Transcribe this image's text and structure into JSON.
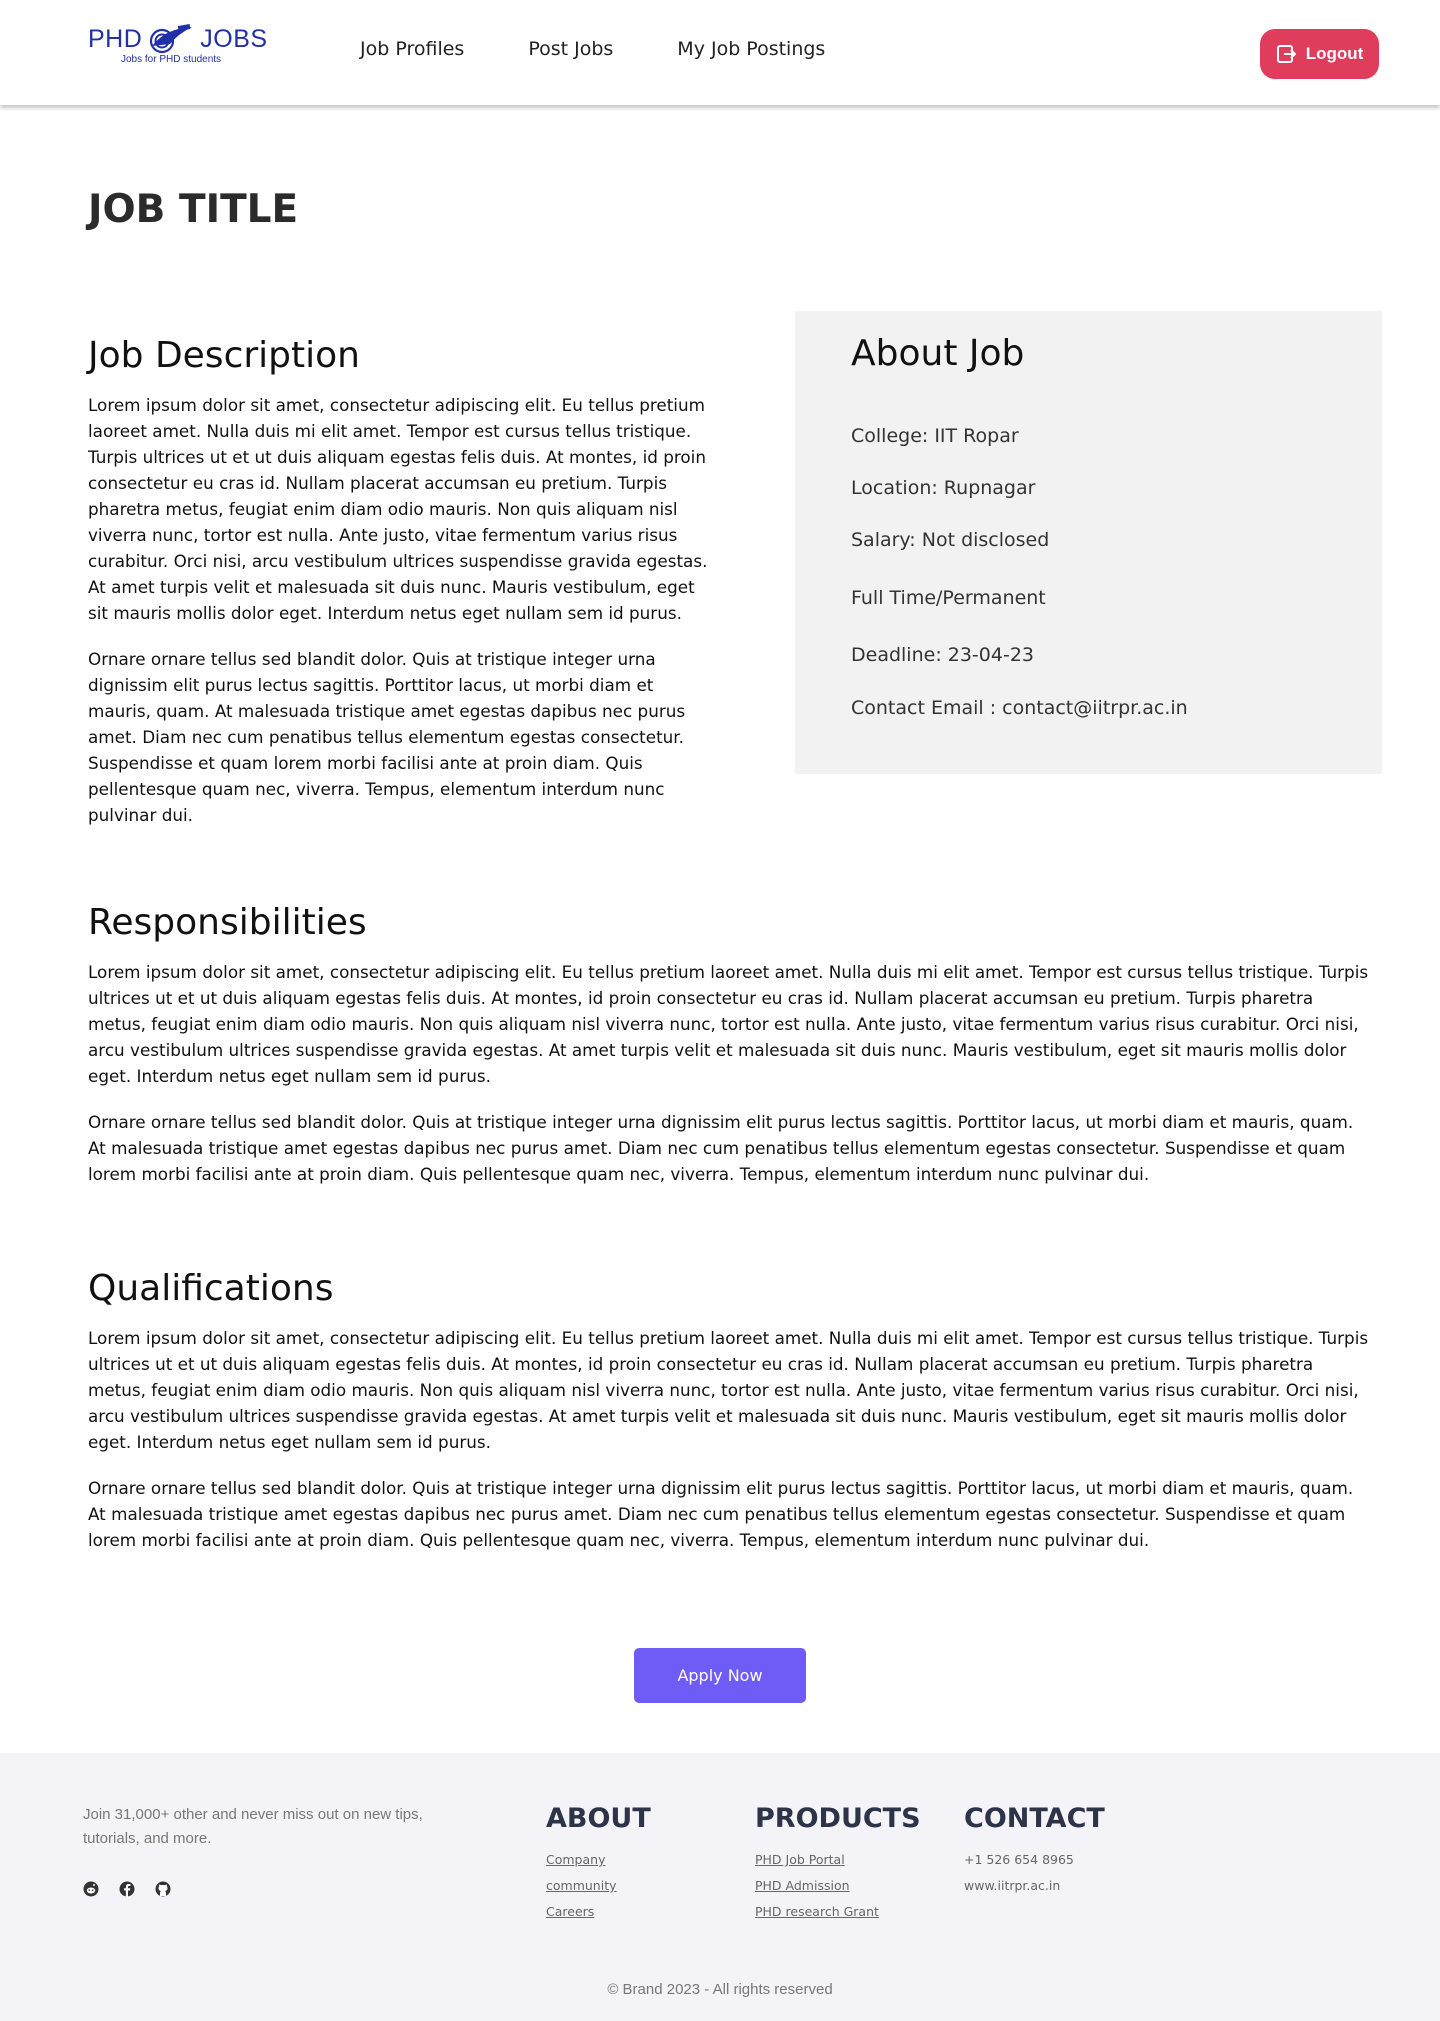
{
  "header": {
    "logo": {
      "word1": "PHD",
      "word2": "JOBS",
      "tagline": "Jobs for PHD students"
    },
    "nav": [
      {
        "label": "Job Profiles"
      },
      {
        "label": "Post Jobs"
      },
      {
        "label": "My Job Postings"
      }
    ],
    "logout_label": "Logout"
  },
  "job": {
    "title": "JOB TITLE",
    "description": {
      "heading": "Job Description",
      "paragraphs": [
        "Lorem ipsum dolor sit amet, consectetur adipiscing elit. Eu tellus pretium laoreet amet. Nulla duis mi elit amet. Tempor est cursus tellus tristique. Turpis ultrices ut et ut duis aliquam egestas felis duis. At montes, id proin consectetur eu cras id. Nullam placerat accumsan eu pretium. Turpis pharetra metus, feugiat enim diam odio mauris. Non quis aliquam nisl viverra nunc, tortor est nulla. Ante justo, vitae fermentum varius risus curabitur. Orci nisi, arcu vestibulum ultrices suspendisse gravida egestas. At amet turpis velit et malesuada sit duis nunc. Mauris vestibulum, eget sit mauris mollis dolor eget. Interdum netus eget nullam sem id purus.",
        "Ornare ornare tellus sed blandit dolor. Quis at tristique integer urna dignissim elit purus lectus sagittis. Porttitor lacus, ut morbi diam et mauris, quam. At malesuada tristique amet egestas dapibus nec purus amet. Diam nec cum penatibus tellus elementum egestas consectetur. Suspendisse et quam lorem morbi facilisi ante at proin diam. Quis pellentesque quam nec, viverra. Tempus, elementum interdum nunc pulvinar dui."
      ]
    },
    "about": {
      "heading": "About Job",
      "college": "College: IIT Ropar",
      "location": "Location: Rupnagar",
      "salary": "Salary: Not disclosed",
      "type": "Full Time/Permanent",
      "deadline": "Deadline: 23-04-23",
      "email": "Contact Email : contact@iitrpr.ac.in"
    },
    "responsibilities": {
      "heading": "Responsibilities",
      "paragraphs": [
        "Lorem ipsum dolor sit amet, consectetur adipiscing elit. Eu tellus pretium laoreet amet. Nulla duis mi elit amet. Tempor est cursus tellus tristique. Turpis ultrices ut et ut duis aliquam egestas felis duis. At montes, id proin consectetur eu cras id. Nullam placerat accumsan eu pretium. Turpis pharetra metus, feugiat enim diam odio mauris. Non quis aliquam nisl viverra nunc, tortor est nulla. Ante justo, vitae fermentum varius risus curabitur. Orci nisi, arcu vestibulum ultrices suspendisse gravida egestas. At amet turpis velit et malesuada sit duis nunc. Mauris vestibulum, eget sit mauris mollis dolor eget. Interdum netus eget nullam sem id purus.",
        "Ornare ornare tellus sed blandit dolor. Quis at tristique integer urna dignissim elit purus lectus sagittis. Porttitor lacus, ut morbi diam et mauris, quam. At malesuada tristique amet egestas dapibus nec purus amet. Diam nec cum penatibus tellus elementum egestas consectetur. Suspendisse et quam lorem morbi facilisi ante at proin diam. Quis pellentesque quam nec, viverra. Tempus, elementum interdum nunc pulvinar dui."
      ]
    },
    "qualifications": {
      "heading": "Qualifications",
      "paragraphs": [
        "Lorem ipsum dolor sit amet, consectetur adipiscing elit. Eu tellus pretium laoreet amet. Nulla duis mi elit amet. Tempor est cursus tellus tristique. Turpis ultrices ut et ut duis aliquam egestas felis duis. At montes, id proin consectetur eu cras id. Nullam placerat accumsan eu pretium. Turpis pharetra metus, feugiat enim diam odio mauris. Non quis aliquam nisl viverra nunc, tortor est nulla. Ante justo, vitae fermentum varius risus curabitur. Orci nisi, arcu vestibulum ultrices suspendisse gravida egestas. At amet turpis velit et malesuada sit duis nunc. Mauris vestibulum, eget sit mauris mollis dolor eget. Interdum netus eget nullam sem id purus.",
        "Ornare ornare tellus sed blandit dolor. Quis at tristique integer urna dignissim elit purus lectus sagittis. Porttitor lacus, ut morbi diam et mauris, quam. At malesuada tristique amet egestas dapibus nec purus amet. Diam nec cum penatibus tellus elementum egestas consectetur. Suspendisse et quam lorem morbi facilisi ante at proin diam. Quis pellentesque quam nec, viverra. Tempus, elementum interdum nunc pulvinar dui."
      ]
    },
    "apply_label": "Apply Now"
  },
  "footer": {
    "join_text": "Join 31,000+ other and never miss out on new tips, tutorials, and more.",
    "social_icons": [
      "reddit-icon",
      "facebook-icon",
      "github-icon"
    ],
    "about": {
      "heading": "ABOUT",
      "links": [
        "Company",
        "community",
        "Careers"
      ]
    },
    "products": {
      "heading": "PRODUCTS",
      "links": [
        "PHD Job Portal",
        "PHD Admission",
        "PHD research Grant"
      ]
    },
    "contact": {
      "heading": "CONTACT",
      "phone": "+1 526 654 8965",
      "website": "www.iitrpr.ac.in"
    },
    "copyright": "© Brand 2023 - All rights reserved"
  },
  "colors": {
    "brand_blue": "#2230a8",
    "logout_red": "#e03c5c",
    "apply_purple": "#6f5cf6",
    "panel_gray": "#f2f2f2",
    "footer_bg": "#f4f4f8"
  }
}
